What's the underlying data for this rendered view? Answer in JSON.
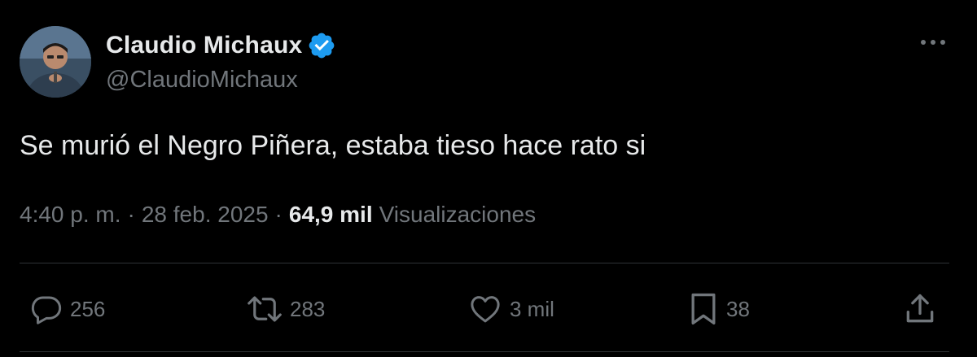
{
  "author": {
    "display_name": "Claudio Michaux",
    "handle": "@ClaudioMichaux",
    "verified": true
  },
  "tweet": {
    "text": "Se murió el Negro Piñera, estaba tieso hace rato si",
    "time": "4:40 p. m.",
    "separator": "·",
    "date": "28 feb. 2025",
    "views_count": "64,9 mil",
    "views_label": "Visualizaciones"
  },
  "actions": {
    "replies": "256",
    "reposts": "283",
    "likes": "3 mil",
    "bookmarks": "38"
  },
  "icons": {
    "verified": "verified-badge-icon",
    "more": "more-options-icon",
    "reply": "reply-icon",
    "repost": "repost-icon",
    "like": "heart-icon",
    "bookmark": "bookmark-icon",
    "share": "share-icon"
  },
  "colors": {
    "background": "#000000",
    "primary_text": "#e7e9ea",
    "secondary_text": "#71767b",
    "divider": "#2f3336",
    "verified_blue": "#1d9bf0"
  }
}
